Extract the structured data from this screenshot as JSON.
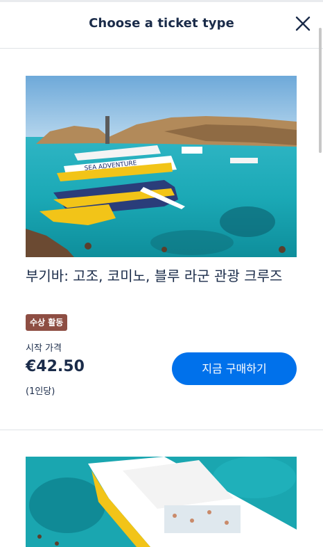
{
  "header": {
    "title": "Choose a ticket type",
    "close_icon": "close-icon"
  },
  "ticket": {
    "image_text": "SEA ADVENTURE",
    "title": "부기바: 고조, 코미노, 블루 라군 관광 크루즈",
    "badge": "수상 활동",
    "price_label": "시작 가격",
    "price": "€42.50",
    "per_person": "(1인당)",
    "buy_label": "지금 구매하기"
  },
  "colors": {
    "accent": "#0071eb",
    "badge": "#8e4e43",
    "text": "#1a2b49"
  }
}
